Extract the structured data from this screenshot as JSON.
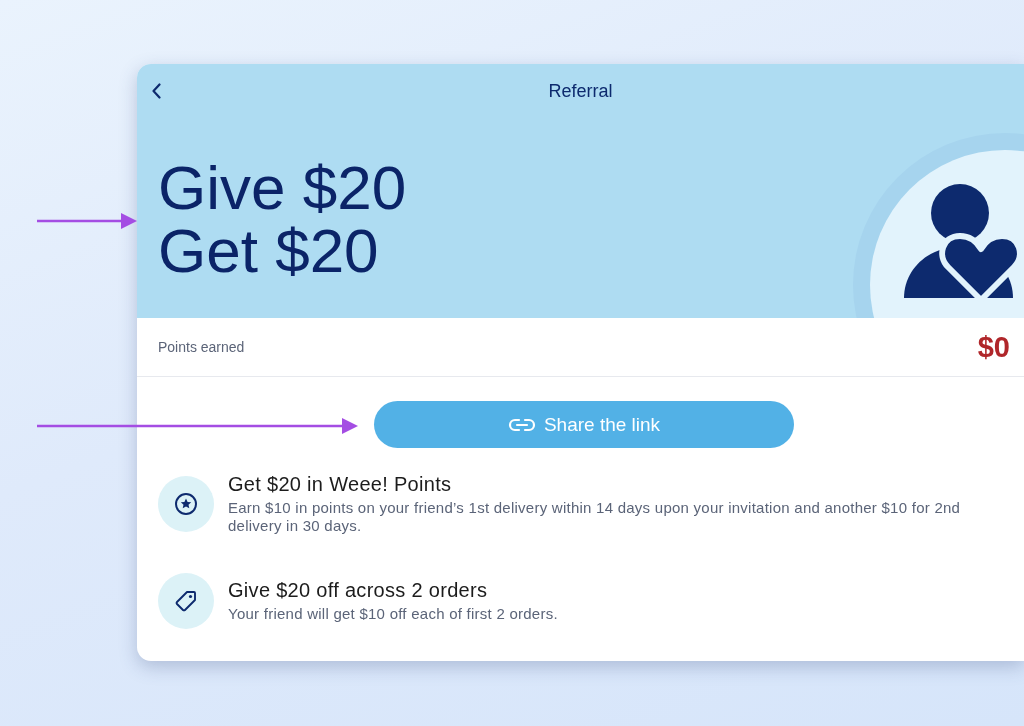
{
  "header": {
    "title": "Referral"
  },
  "headline": [
    "Give $20",
    "Get $20"
  ],
  "points": {
    "label": "Points earned",
    "value": "$0"
  },
  "share_button": {
    "label": "Share the link"
  },
  "benefits": [
    {
      "kind": "points",
      "title": "Get $20 in Weee! Points",
      "description": "Earn $10 in points on your friend’s 1st delivery within 14 days upon your invitation and another $10 for 2nd delivery in 30 days."
    },
    {
      "kind": "discount",
      "title": "Give $20 off across 2 orders",
      "description": "Your friend will get $10 off each of first 2 orders."
    }
  ]
}
